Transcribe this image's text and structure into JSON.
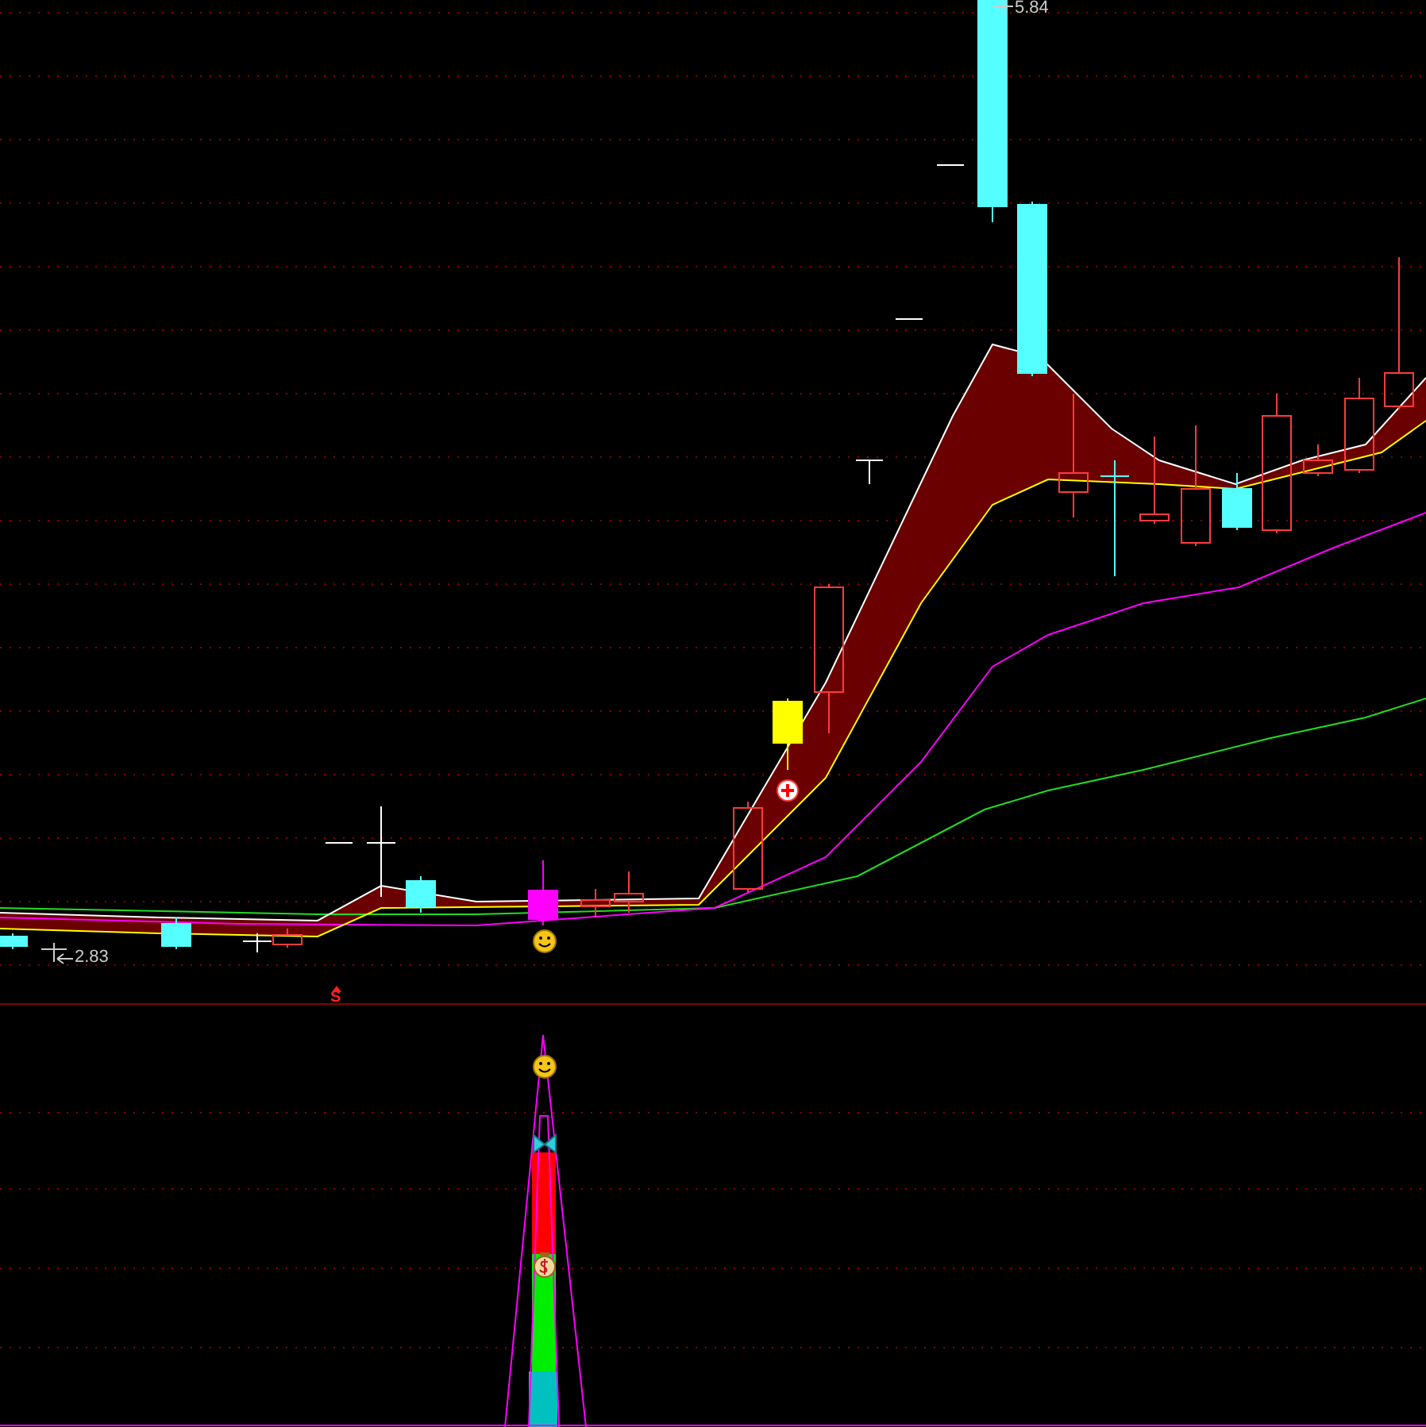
{
  "price_chart": {
    "high_label": "5.84",
    "low_label": "2.83",
    "signal_label": "S"
  }
}
